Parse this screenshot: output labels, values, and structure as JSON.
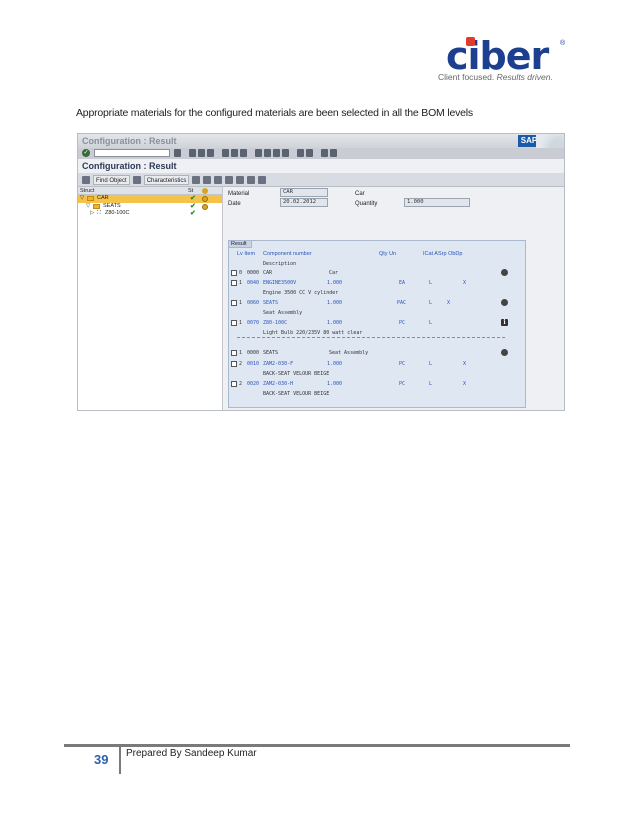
{
  "logo": {
    "word": "ciber",
    "reg": "®",
    "tagline_plain": "Client focused. ",
    "tagline_italic": "Results driven.",
    "accent_color": "#e03a2e",
    "brand_color": "#1c3f8f"
  },
  "intro": "Appropriate materials for the configured materials are been selected in all the BOM levels",
  "sap": {
    "window_title": "Configuration : Result",
    "sap_logo": "SAP",
    "screen_title": "Configuration : Result",
    "toolbar": {
      "find_object": "Find Object",
      "characteristics": "Characteristics"
    },
    "tree": {
      "col_struct": "Struct",
      "col_st": "St",
      "items": [
        {
          "label": "CAR",
          "selected": true
        },
        {
          "label": "SEATS",
          "selected": false
        },
        {
          "label": "Z80-100C",
          "selected": false
        }
      ]
    },
    "header": {
      "material_label": "Material",
      "material_value": "CAR",
      "material_desc": "Car",
      "date_label": "Date",
      "date_value": "20.02.2012",
      "quantity_label": "Quantity",
      "quantity_value": "1.000"
    },
    "result": {
      "tab": "Result",
      "headers": {
        "lv_item": "Lv Item",
        "component": "Component number",
        "description": "Description",
        "qty_un": "Qty Un",
        "icat": "ICat ASrp ObDp"
      },
      "rows": [
        {
          "lv": "0",
          "item": "0000",
          "comp": "CAR",
          "desc_inline": "Car",
          "qty": "",
          "un": "",
          "icat": "",
          "asrp": ""
        },
        {
          "lv": "1",
          "item": "0040",
          "comp": "ENGINE3500V",
          "qty": "1.000",
          "un": "EA",
          "icat": "L",
          "asrp": "X",
          "desc": "Engine 3500 CC V cylinder"
        },
        {
          "lv": "1",
          "item": "0060",
          "comp": "SEATS",
          "qty": "1.000",
          "un": "PAC",
          "icat": "L",
          "asrp": "X",
          "desc": "Seat Assembly"
        },
        {
          "lv": "1",
          "item": "0070",
          "comp": "Z80-100C",
          "qty": "1.000",
          "un": "PC",
          "icat": "L",
          "asrp": "",
          "desc": "Light Bulb 220/235V 80 watt clear"
        },
        {
          "lv": "1",
          "item": "0000",
          "comp": "SEATS",
          "desc_inline": "Seat Assembly",
          "qty": "",
          "un": "",
          "icat": "",
          "asrp": ""
        },
        {
          "lv": "2",
          "item": "0010",
          "comp": "ZAM2-030-F",
          "qty": "1.000",
          "un": "PC",
          "icat": "L",
          "asrp": "X",
          "desc": "BACK-SEAT VELOUR BEIGE"
        },
        {
          "lv": "2",
          "item": "0020",
          "comp": "ZAM2-030-H",
          "qty": "1.000",
          "un": "PC",
          "icat": "L",
          "asrp": "X",
          "desc": "BACK-SEAT VELOUR BEIGE"
        }
      ]
    }
  },
  "footer": {
    "page_number": "39",
    "prepared_by": "Prepared By Sandeep Kumar"
  }
}
